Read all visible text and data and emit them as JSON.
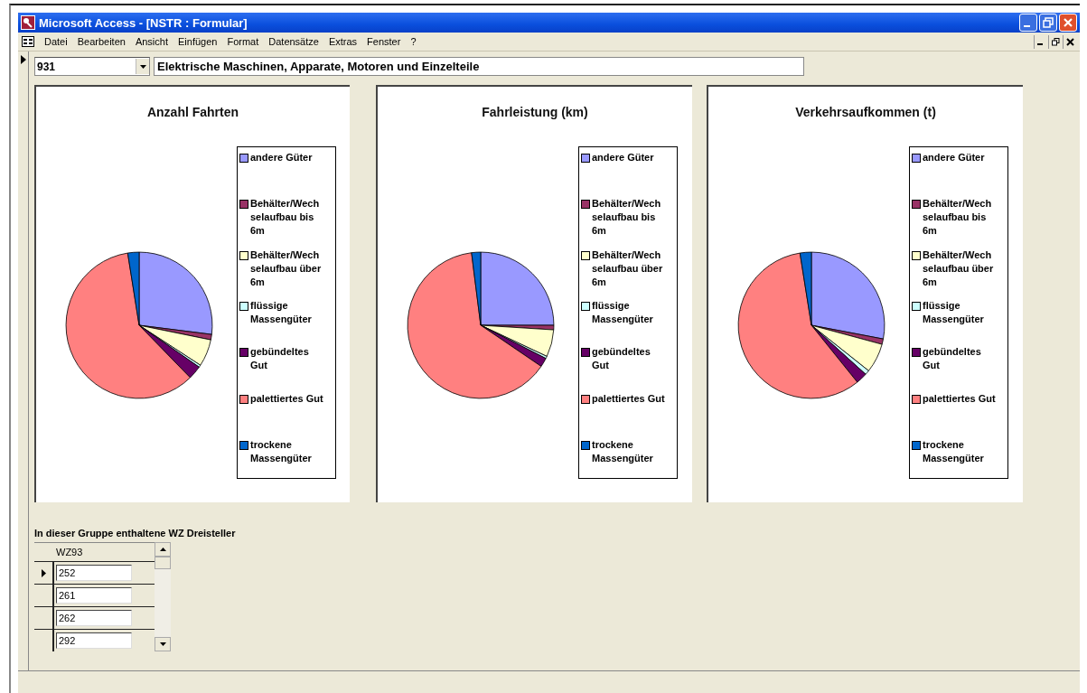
{
  "window": {
    "title": "Microsoft Access - [NSTR : Formular]"
  },
  "menu_bar": {
    "items": [
      "Datei",
      "Bearbeiten",
      "Ansicht",
      "Einfügen",
      "Format",
      "Datensätze",
      "Extras",
      "Fenster",
      "?"
    ]
  },
  "record": {
    "code": "931",
    "description": "Elektrische Maschinen, Apparate, Motoren und Einzelteile"
  },
  "charts": [
    {
      "title": "Anzahl Fahrten",
      "legend": [
        {
          "label": "andere Güter",
          "color": "#9999ff"
        },
        {
          "label": "Behälter/Wechselaufbau bis 6m",
          "color": "#993366"
        },
        {
          "label": "Behälter/Wechselaufbau über 6m",
          "color": "#ffffcc"
        },
        {
          "label": "flüssige Massengüter",
          "color": "#ccffff"
        },
        {
          "label": "gebündeltes Gut",
          "color": "#660066"
        },
        {
          "label": "palettiertes Gut",
          "color": "#ff8080"
        },
        {
          "label": "trockene Massengüter",
          "color": "#0066cc"
        }
      ]
    },
    {
      "title": "Fahrleistung (km)",
      "legend": [
        {
          "label": "andere Güter",
          "color": "#9999ff"
        },
        {
          "label": "Behälter/Wechselaufbau bis 6m",
          "color": "#993366"
        },
        {
          "label": "Behälter/Wechselaufbau über 6m",
          "color": "#ffffcc"
        },
        {
          "label": "flüssige Massengüter",
          "color": "#ccffff"
        },
        {
          "label": "gebündeltes Gut",
          "color": "#660066"
        },
        {
          "label": "palettiertes Gut",
          "color": "#ff8080"
        },
        {
          "label": "trockene Massengüter",
          "color": "#0066cc"
        }
      ]
    },
    {
      "title": "Verkehrsaufkommen (t)",
      "legend": [
        {
          "label": "andere Güter",
          "color": "#9999ff"
        },
        {
          "label": "Behälter/Wechselaufbau bis 6m",
          "color": "#993366"
        },
        {
          "label": "Behälter/Wechselaufbau über 6m",
          "color": "#ffffcc"
        },
        {
          "label": "flüssige Massengüter",
          "color": "#ccffff"
        },
        {
          "label": "gebündeltes Gut",
          "color": "#660066"
        },
        {
          "label": "palettiertes Gut",
          "color": "#ff8080"
        },
        {
          "label": "trockene Massengüter",
          "color": "#0066cc"
        }
      ]
    }
  ],
  "subform": {
    "label": "In dieser Gruppe enthaltene WZ Dreisteller",
    "column": "WZ93",
    "rows": [
      {
        "value": "252",
        "selected": true
      },
      {
        "value": "261",
        "selected": false
      },
      {
        "value": "262",
        "selected": false
      },
      {
        "value": "292",
        "selected": false
      }
    ]
  }
}
